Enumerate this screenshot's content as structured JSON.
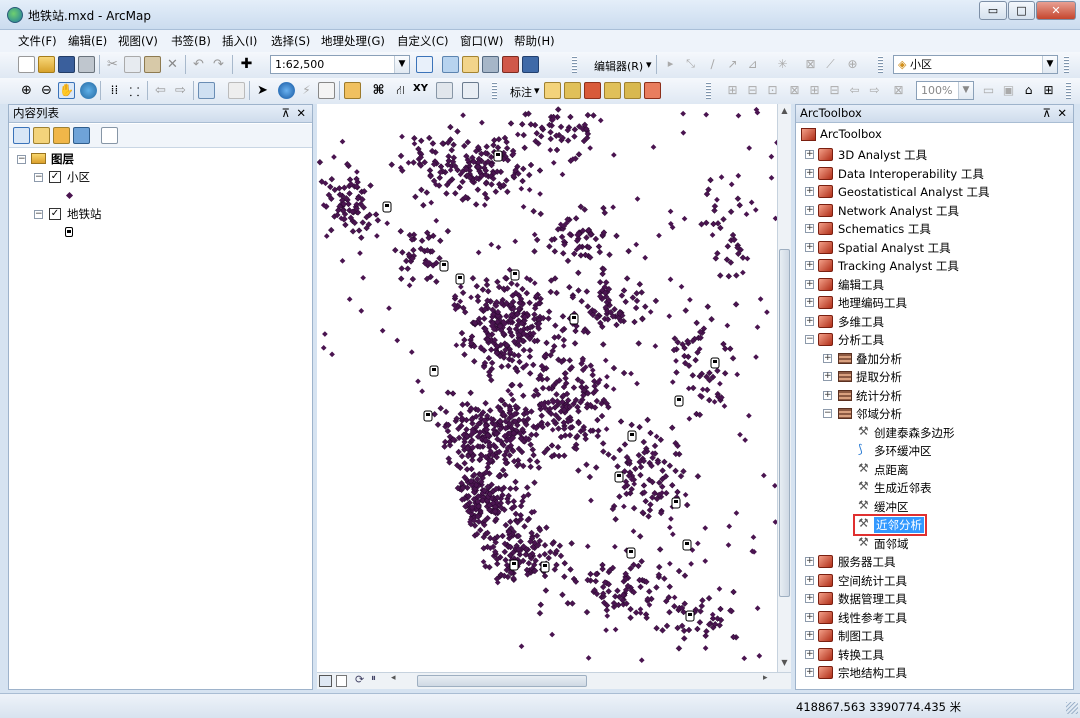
{
  "window": {
    "title": "地铁站.mxd - ArcMap",
    "minimize": "▭",
    "maximize": "□",
    "close": "✕"
  },
  "menu": [
    "文件(F)",
    "编辑(E)",
    "视图(V)",
    "书签(B)",
    "插入(I)",
    "选择(S)",
    "地理处理(G)",
    "自定义(C)",
    "窗口(W)",
    "帮助(H)"
  ],
  "toolbar": {
    "scale": "1:62,500",
    "editor_label": "编辑器(R)",
    "layer_select": "小区",
    "label_menu": "标注",
    "zoom_percent": "100%"
  },
  "toc": {
    "title": "内容列表",
    "pin": "⊼",
    "close": "✕",
    "root": "图层",
    "layers": [
      {
        "name": "小区",
        "checked": true,
        "symbol": "point"
      },
      {
        "name": "地铁站",
        "checked": true,
        "symbol": "station"
      }
    ]
  },
  "toolbox": {
    "title": "ArcToolbox",
    "pin": "⊼",
    "close": "✕",
    "root": "ArcToolbox",
    "items": [
      "3D Analyst 工具",
      "Data Interoperability 工具",
      "Geostatistical Analyst 工具",
      "Network Analyst 工具",
      "Schematics 工具",
      "Spatial Analyst 工具",
      "Tracking Analyst 工具",
      "编辑工具",
      "地理编码工具",
      "多维工具",
      "分析工具"
    ],
    "analysis_sub": [
      "叠加分析",
      "提取分析",
      "统计分析",
      "邻域分析"
    ],
    "neighborhood_tools": [
      "创建泰森多边形",
      "多环缓冲区",
      "点距离",
      "生成近邻表",
      "缓冲区",
      "近邻分析",
      "面邻域"
    ],
    "highlighted_tool": "近邻分析",
    "more_items": [
      "服务器工具",
      "空间统计工具",
      "数据管理工具",
      "线性参考工具",
      "制图工具",
      "转换工具",
      "宗地结构工具"
    ]
  },
  "status": {
    "coords": "418867.563  3390774.435 米"
  },
  "colors": {
    "point": "#4a1450",
    "highlight_border": "#e03030",
    "selection": "#3399ff"
  }
}
